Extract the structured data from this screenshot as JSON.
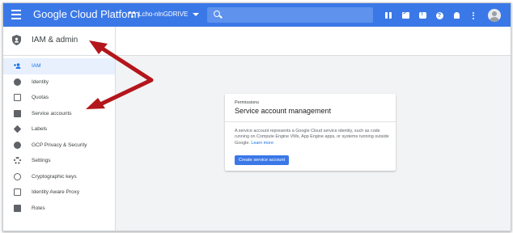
{
  "topbar": {
    "brand": "Google Cloud Platform",
    "project": "Lcho-nlnGDRIVE",
    "search_placeholder": "",
    "icons": [
      "gift-icon",
      "cloud-shell-icon",
      "notifications-chat-icon",
      "help-icon",
      "bell-icon",
      "more-vert-icon",
      "account-avatar-icon"
    ],
    "accent": "#3b78e7"
  },
  "sidebar": {
    "title": "IAM & admin",
    "items": [
      {
        "label": "IAM",
        "icon": "person-add-icon",
        "active": true
      },
      {
        "label": "Identity",
        "icon": "account-circle-icon"
      },
      {
        "label": "Quotas",
        "icon": "quota-icon"
      },
      {
        "label": "Service accounts",
        "icon": "service-account-icon"
      },
      {
        "label": "Labels",
        "icon": "label-icon"
      },
      {
        "label": "GCP Privacy & Security",
        "icon": "privacy-icon"
      },
      {
        "label": "Settings",
        "icon": "settings-icon"
      },
      {
        "label": "Cryptographic keys",
        "icon": "key-icon"
      },
      {
        "label": "Identity Aware Proxy",
        "icon": "proxy-icon"
      },
      {
        "label": "Roles",
        "icon": "roles-icon"
      }
    ]
  },
  "card": {
    "eyebrow": "Permissions",
    "title": "Service account management",
    "body": "A service account represents a Google Cloud service identity, such as code running on Compute Engine VMs, App Engine apps, or systems running outside Google.",
    "link": "Learn more",
    "button": "Create service account"
  },
  "annotation": {
    "arrow_color": "#b3161b"
  }
}
